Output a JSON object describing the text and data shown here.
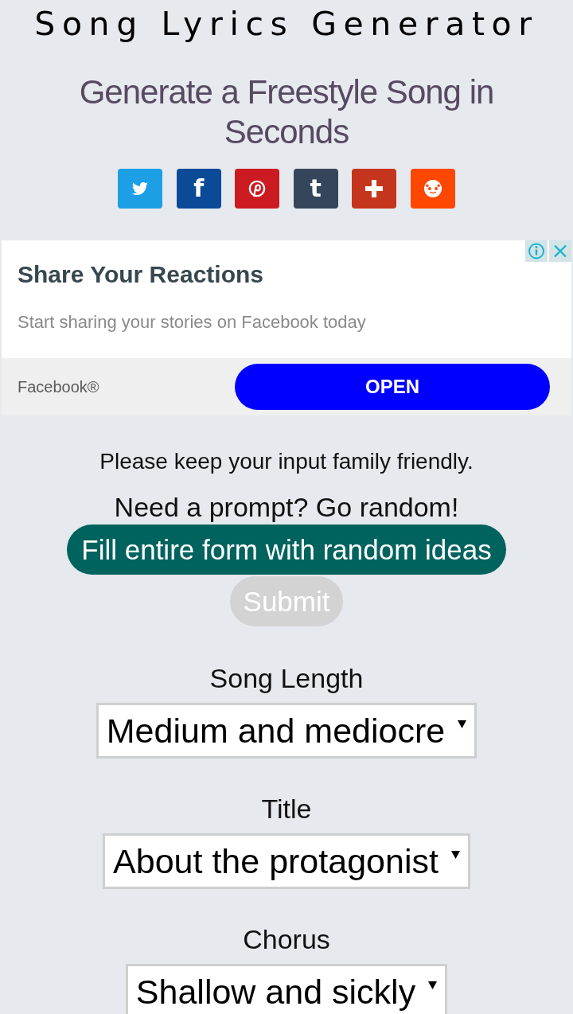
{
  "header": {
    "title": "Song Lyrics Generator",
    "subtitle": "Generate a Freestyle Song in Seconds"
  },
  "share_buttons": [
    {
      "kind": "bird",
      "color": "#1d9fe6"
    },
    {
      "kind": "letter",
      "glyph": "f",
      "color": "#0b4a96"
    },
    {
      "kind": "pin",
      "color": "#cb1a20"
    },
    {
      "kind": "letter",
      "glyph": "t",
      "color": "#35465c"
    },
    {
      "kind": "plus",
      "color": "#c5351d"
    },
    {
      "kind": "alien",
      "color": "#fe4700"
    }
  ],
  "ad": {
    "title": "Share Your Reactions",
    "text": "Start sharing your stories on Facebook today",
    "advertiser": "Facebook®",
    "button": "OPEN"
  },
  "form": {
    "notice": "Please keep your input family friendly.",
    "prompt": "Need a prompt? Go random!",
    "random_button": "Fill entire form with random ideas",
    "submit_button": {
      "label": "Submit",
      "disabled": true
    },
    "fields": [
      {
        "label": "Song Length",
        "value": "Medium and mediocre"
      },
      {
        "label": "Title",
        "value": "About the protagonist"
      },
      {
        "label": "Chorus",
        "value": "Shallow and sickly"
      }
    ]
  }
}
